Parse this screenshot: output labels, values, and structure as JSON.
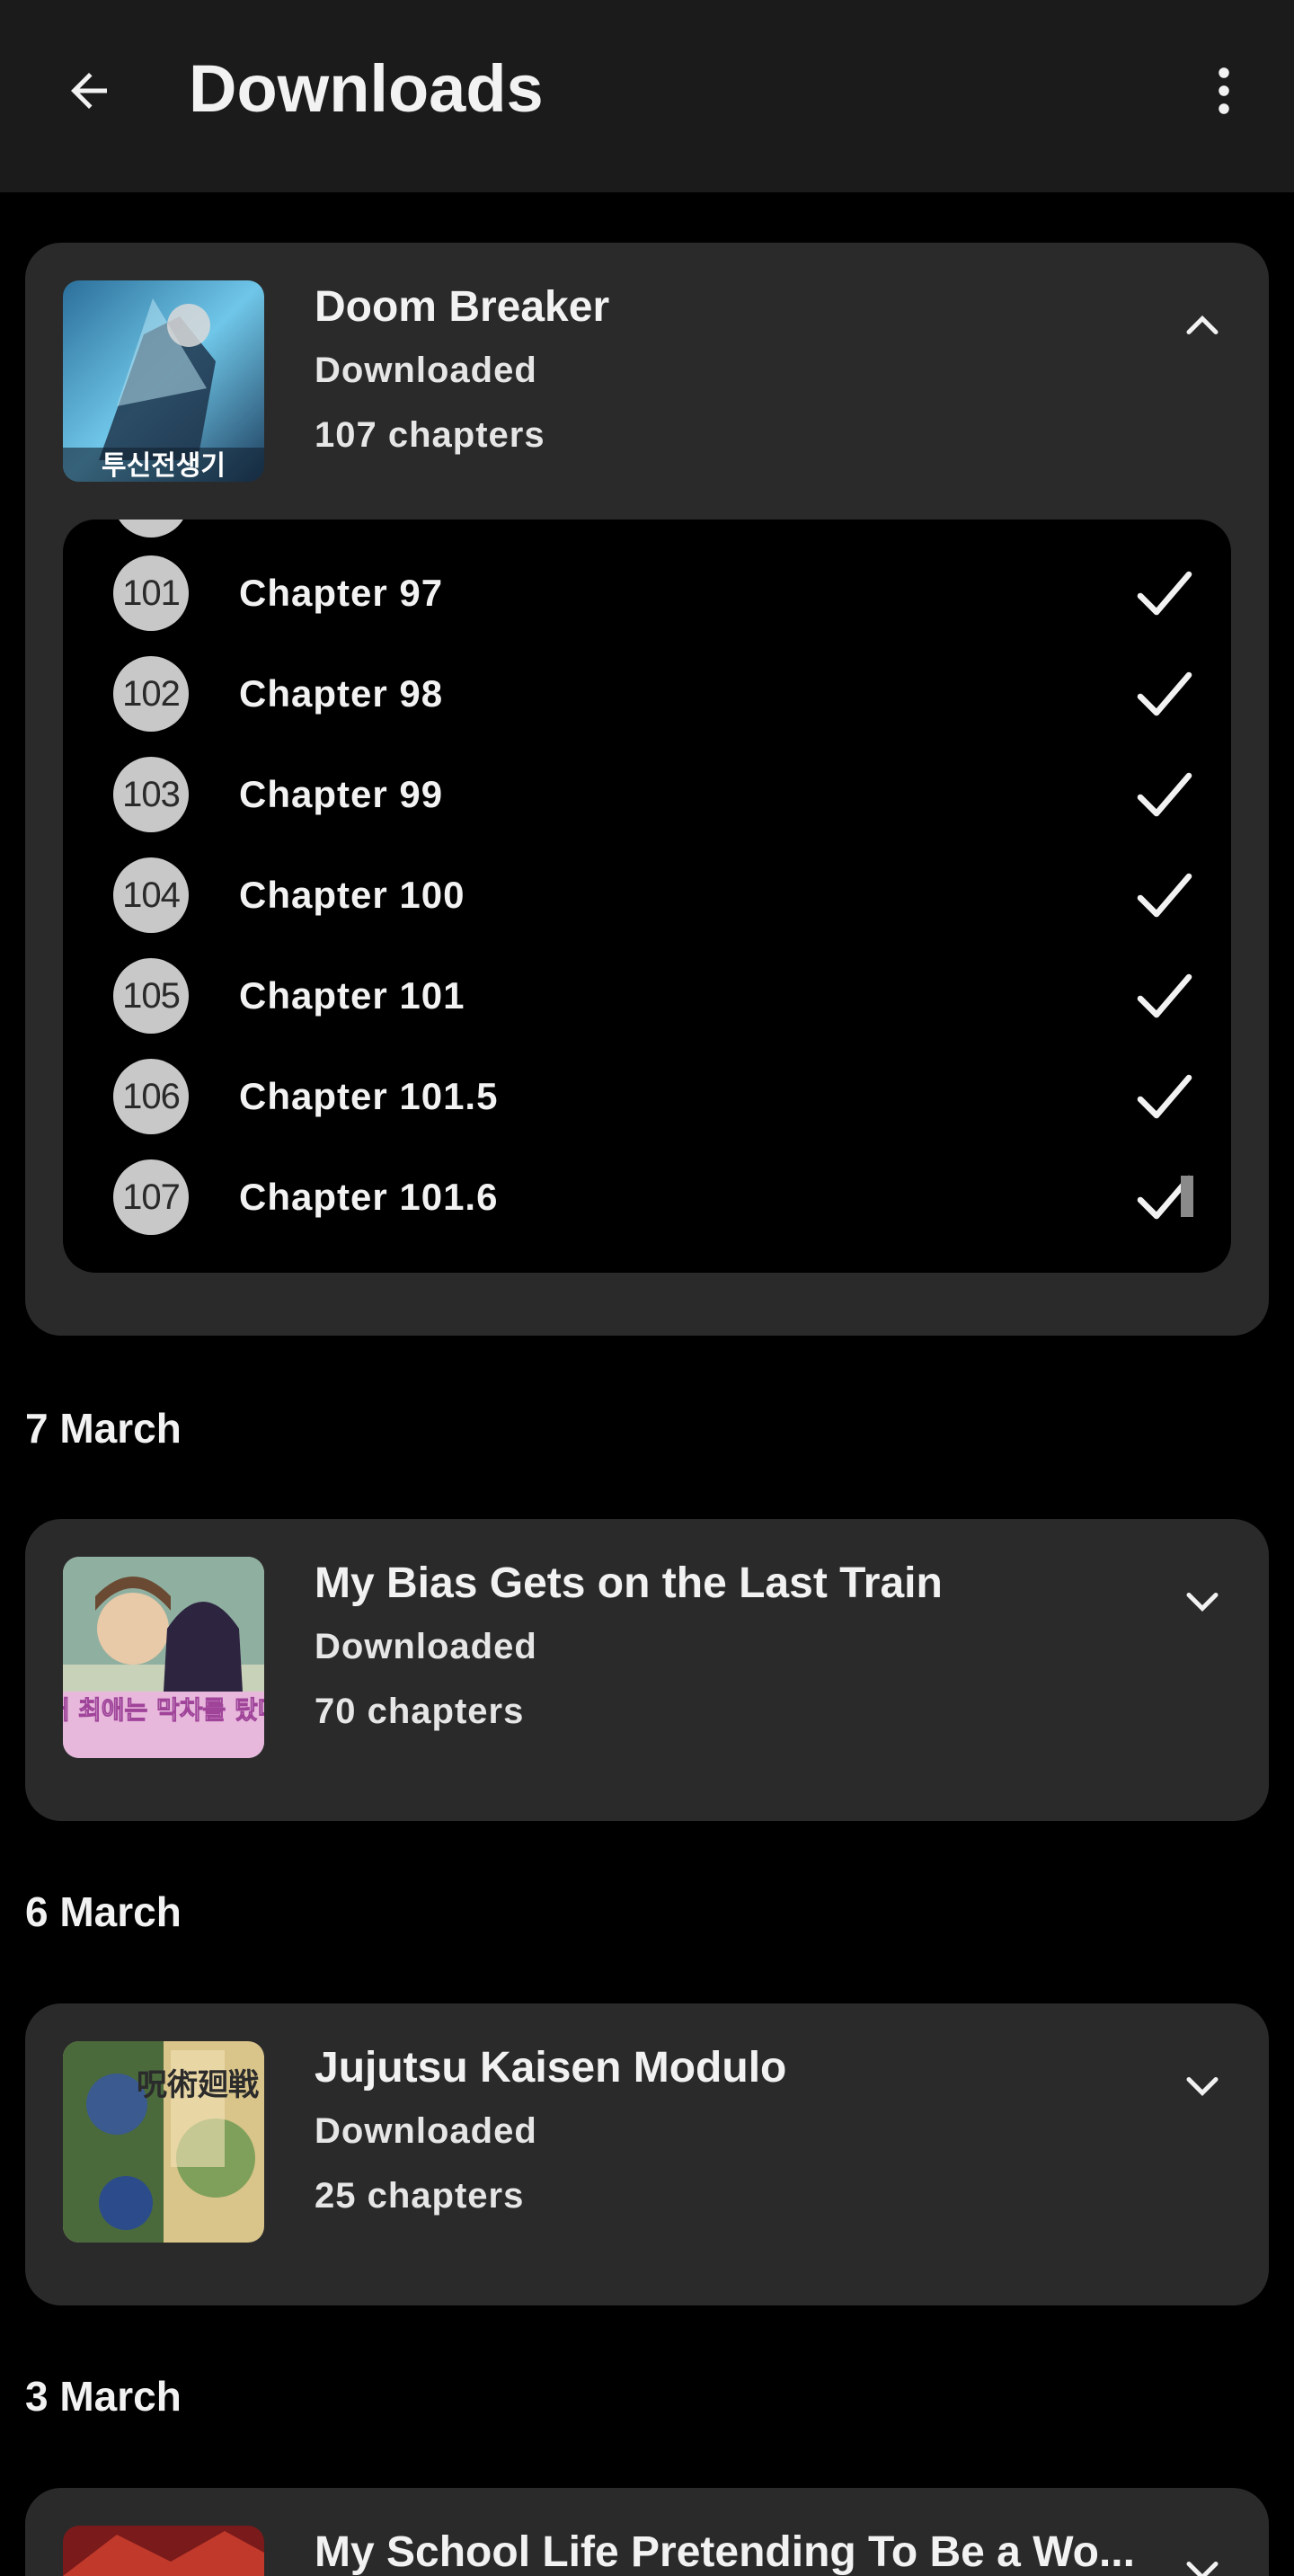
{
  "header": {
    "title": "Downloads",
    "back_icon": "arrow-left-icon",
    "menu_icon": "more-vertical-icon"
  },
  "expanded_series": {
    "title": "Doom Breaker",
    "status": "Downloaded",
    "count": "107 chapters",
    "cover_text": "투신전생기",
    "chevron": "chevron-up-icon",
    "chapters": [
      {
        "num": "101",
        "label": "Chapter 97"
      },
      {
        "num": "102",
        "label": "Chapter 98"
      },
      {
        "num": "103",
        "label": "Chapter 99"
      },
      {
        "num": "104",
        "label": "Chapter 100"
      },
      {
        "num": "105",
        "label": "Chapter 101"
      },
      {
        "num": "106",
        "label": "Chapter 101.5"
      },
      {
        "num": "107",
        "label": "Chapter 101.6"
      }
    ]
  },
  "groups": [
    {
      "date": "7 March",
      "title": "My Bias Gets on the Last Train",
      "status": "Downloaded",
      "count": "70 chapters",
      "cover_text": "내 최애는 막차를 탔다"
    },
    {
      "date": "6 March",
      "title": "Jujutsu Kaisen Modulo",
      "status": "Downloaded",
      "count": "25 chapters",
      "cover_text": "呪術廻戦"
    },
    {
      "date": "3 March",
      "title": "My School Life Pretending To Be a Wo...",
      "status": "",
      "count": ""
    }
  ],
  "colors": {
    "background": "#000000",
    "appbar": "#1b1b1b",
    "card": "#2a2a2a",
    "badge": "#c8c8c8"
  }
}
